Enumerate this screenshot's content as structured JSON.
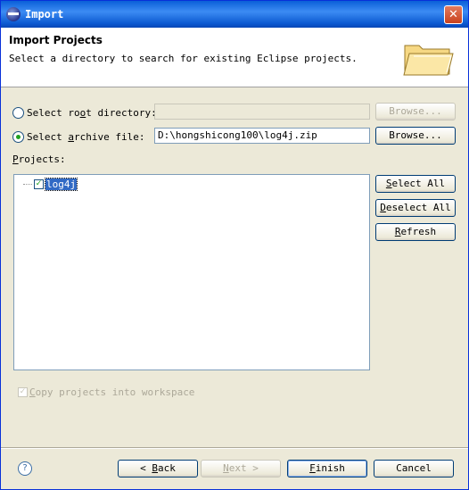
{
  "window": {
    "title": "Import",
    "close_glyph": "✕"
  },
  "header": {
    "title": "Import Projects",
    "description": "Select a directory to search for existing Eclipse projects."
  },
  "source": {
    "root_dir_label_pre": "Select ro",
    "root_dir_label_u": "o",
    "root_dir_label_post": "t directory:",
    "root_dir_value": "",
    "archive_label_pre": "Select ",
    "archive_label_u": "a",
    "archive_label_post": "rchive file:",
    "archive_value": "D:\\hongshicong100\\log4j.zip",
    "selected": "archive",
    "browse_label_root": "Browse...",
    "browse_label_archive": "Browse..."
  },
  "projects": {
    "label_u": "P",
    "label_post": "rojects:",
    "items": [
      {
        "name": "log4j",
        "checked": true
      }
    ],
    "check_glyph": "✓",
    "select_all": {
      "pre": "",
      "u": "S",
      "post": "elect All"
    },
    "deselect_all": {
      "pre": "",
      "u": "D",
      "post": "eselect All"
    },
    "refresh": {
      "pre": "",
      "u": "R",
      "post": "efresh"
    }
  },
  "options": {
    "copy_u": "C",
    "copy_post": "opy projects into workspace",
    "copy_checked": true
  },
  "footer": {
    "help_glyph": "?",
    "back": {
      "pre": "< ",
      "u": "B",
      "post": "ack"
    },
    "next": {
      "pre": "",
      "u": "N",
      "post": "ext >"
    },
    "finish": {
      "pre": "",
      "u": "F",
      "post": "inish"
    },
    "cancel": "Cancel"
  },
  "colors": {
    "titlebar": "#0a5fd8",
    "dialog_bg": "#ece9d8",
    "selection": "#316ac5"
  }
}
